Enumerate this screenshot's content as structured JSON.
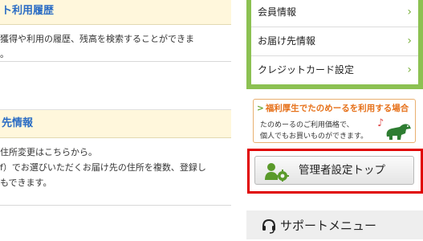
{
  "left": {
    "panel1": {
      "title": "ト利用履歴",
      "lines": [
        "獲得や利用の履歴、残高を検索することができま",
        "。"
      ]
    },
    "panel2": {
      "title": "先情報",
      "lines": [
        "住所変更はこちらから。",
        "f）でお選びいただくお届け先の住所を複数、登録し",
        "もできます。"
      ]
    }
  },
  "member_menu": {
    "items": [
      {
        "label": "会員情報"
      },
      {
        "label": "お届け先情報"
      },
      {
        "label": "クレジットカード設定"
      }
    ],
    "chevron": "›",
    "accent": "#8cc152"
  },
  "banner": {
    "title": "福利厚生でたのめーるを利用する場合",
    "line1": "たのめーるのご利用価格で、",
    "line2": "個人でもお買いものができます。",
    "icons": [
      "music-note-icon",
      "dinosaur-mascot-icon"
    ]
  },
  "admin": {
    "label": "管理者設定トップ",
    "icon": "admin-gear-user-icon",
    "highlight_color": "#e00000"
  },
  "support": {
    "label": "サポートメニュー",
    "icon": "headset-icon"
  }
}
